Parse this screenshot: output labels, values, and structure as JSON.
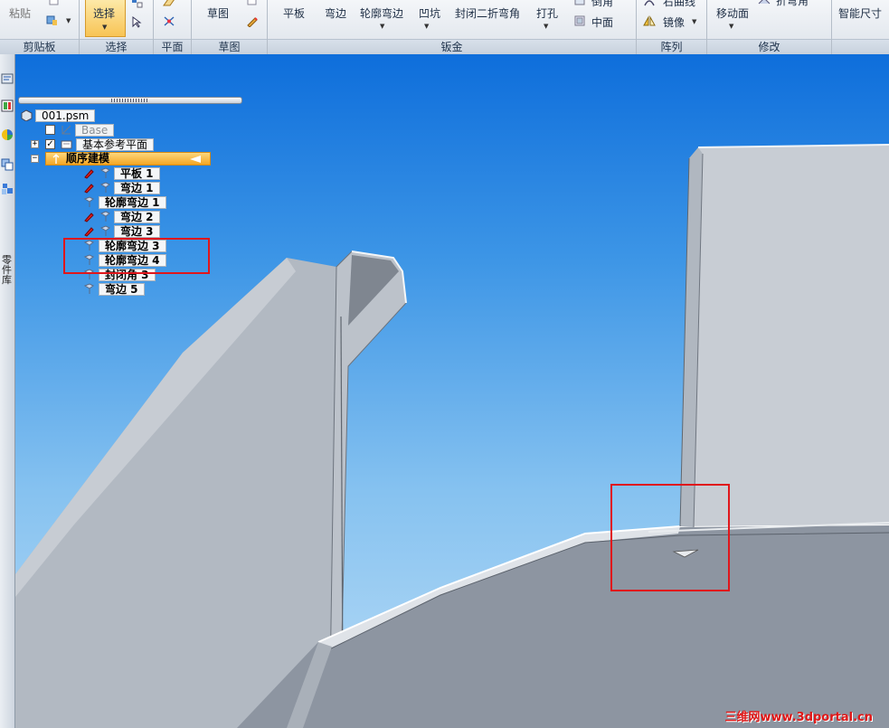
{
  "ribbon": {
    "clipboard": {
      "paste": "粘贴",
      "group": "剪贴板"
    },
    "select": {
      "select": "选择",
      "group": "选择"
    },
    "plane": {
      "group": "平面"
    },
    "sketch": {
      "sketch": "草图",
      "group": "草图"
    },
    "sheetmetal": {
      "items": [
        "平板",
        "弯边",
        "轮廓弯边",
        "凹坑",
        "封闭二折弯角",
        "打孔"
      ],
      "extra_top": "倒角",
      "extra_mid": "中面",
      "group": "钣金"
    },
    "array": {
      "top": "右曲线",
      "mirror": "镜像",
      "group": "阵列"
    },
    "modify": {
      "move_face": "移动面",
      "bend_angle": "折弯角",
      "group": "修改"
    },
    "dimension": {
      "smart": "智能尺寸"
    }
  },
  "side": {
    "tab_text": "零件库"
  },
  "tree": {
    "root": "001.psm",
    "base": "Base",
    "ref_planes": "基本参考平面",
    "sequential": "顺序建模",
    "features": [
      {
        "label": "平板 1",
        "icon": "tab-icon",
        "edit": true
      },
      {
        "label": "弯边 1",
        "icon": "flange-icon",
        "edit": true
      },
      {
        "label": "轮廓弯边 1",
        "icon": "contour-flange-icon",
        "edit": false
      },
      {
        "label": "弯边 2",
        "icon": "flange-icon",
        "edit": true
      },
      {
        "label": "弯边 3",
        "icon": "flange-icon",
        "edit": true
      },
      {
        "label": "轮廓弯边 3",
        "icon": "contour-flange-icon",
        "edit": false
      },
      {
        "label": "轮廓弯边 4",
        "icon": "contour-flange-icon",
        "edit": false
      },
      {
        "label": "封闭角 3",
        "icon": "closed-corner-icon",
        "edit": false
      },
      {
        "label": "弯边 5",
        "icon": "flange-icon",
        "edit": false
      }
    ]
  },
  "watermark": "三维网www.3dportal.cn",
  "colors": {
    "highlight_red": "#e0161b",
    "active_orange": "#f5a623",
    "viewport_top": "#0e6edb",
    "model_gray": "#8d95a1"
  }
}
